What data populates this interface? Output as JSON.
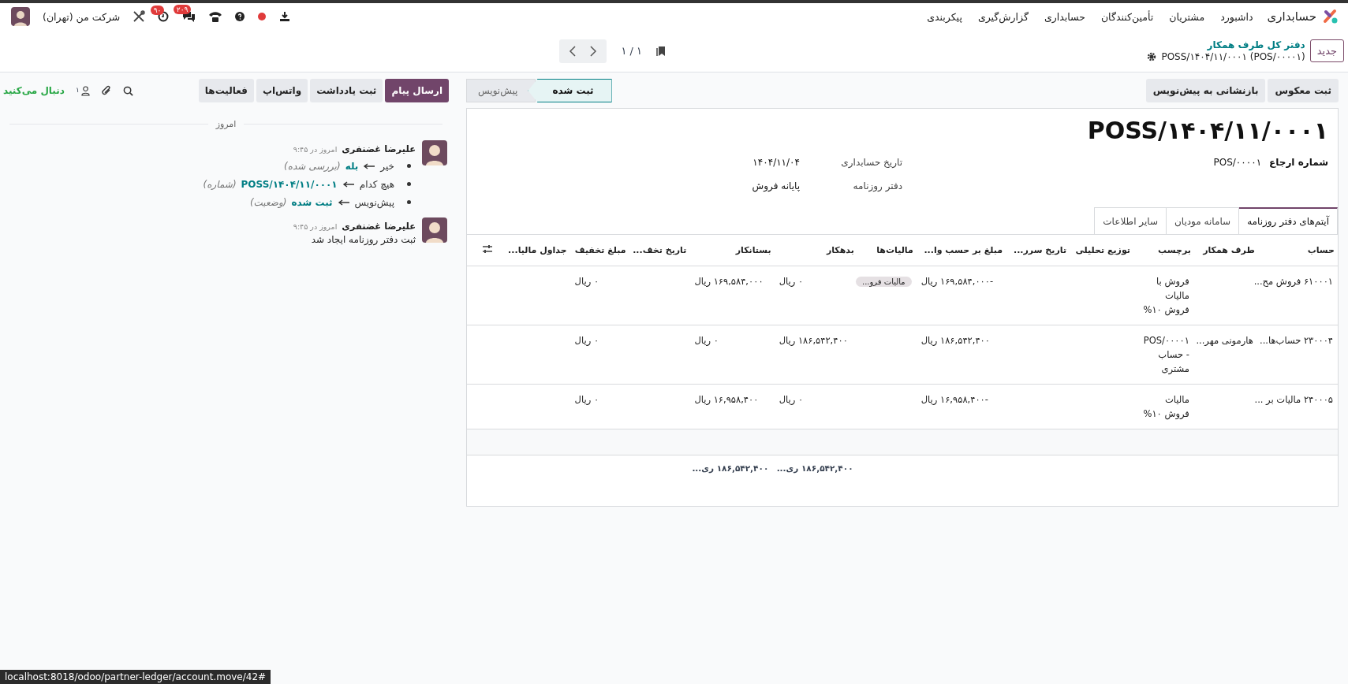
{
  "navbar": {
    "app_title": "حسابداری",
    "menu": [
      "داشبورد",
      "مشتریان",
      "تأمین‌کنندگان",
      "حسابداری",
      "گزارش‌گیری",
      "پیکربندی"
    ],
    "messages_badge": "۲۰۹",
    "activities_badge": "۹۰",
    "company": "شرکت من (تهران)"
  },
  "control_panel": {
    "new_button": "جدید",
    "breadcrumb": "دفتر کل طرف همکار",
    "record_name": "POSS/۱۴۰۴/۱۱/۰۰۰۱ (POS/۰۰۰۰۱)",
    "pager": "۱ / ۱"
  },
  "header_buttons": [
    "ثبت معکوس",
    "بازنشانی به پیش‌نویس"
  ],
  "statusbar": [
    {
      "label": "ثبت شده",
      "selected": true
    },
    {
      "label": "پیش‌نویس",
      "selected": false
    }
  ],
  "sheet": {
    "title": "POSS/۱۴۰۴/۱۱/۰۰۰۱",
    "group_1": [
      {
        "label": "شماره ارجاع",
        "value": "POS/۰۰۰۰۱"
      }
    ],
    "group_2": [
      {
        "label": "تاریخ حسابداری",
        "value": "۱۴۰۴/۱۱/۰۴"
      },
      {
        "label": "دفتر روزنامه",
        "value": "پایانه فروش"
      }
    ],
    "tabs": [
      {
        "label": "آیتم‌های دفتر روزنامه",
        "selected": true
      },
      {
        "label": "سامانه مودیان",
        "selected": false
      },
      {
        "label": "سایر اطلاعات",
        "selected": false
      }
    ],
    "table": {
      "columns": [
        {
          "label": "حساب"
        },
        {
          "label": "طرف همکار"
        },
        {
          "label": "برچسب"
        },
        {
          "label": "توزیع تحلیلی"
        },
        {
          "label": "تاریخ سرر..."
        },
        {
          "label": "مبلغ بر حسب وا..."
        },
        {
          "label": "مالیات‌ها"
        },
        {
          "label": "بدهکار",
          "total": "۱۸۶,۵۴۲,۴۰۰ ری..."
        },
        {
          "label": "بستانکار",
          "total": "۱۸۶,۵۴۲,۴۰۰ ری..."
        },
        {
          "label": "تاریخ تخف..."
        },
        {
          "label": "مبلغ تخفیف"
        },
        {
          "label": "جداول مالیا..."
        }
      ],
      "rows": [
        [
          "۶۱۰۰۰۱ فروش مح...",
          null,
          "فروش  با مالیات فروش ۱۰%",
          null,
          null,
          "-۱۶۹,۵۸۴,۰۰۰ ریال",
          [
            "مالیات فرو..."
          ],
          "۰ ریال",
          "۱۶۹,۵۸۴,۰۰۰ ریال",
          null,
          "۰ ریال",
          null
        ],
        [
          "۲۳۰۰۰۴ حساب‌ها...",
          "هارمونی مهر...",
          "POS/۰۰۰۰۱ - حساب مشتری",
          null,
          null,
          "۱۸۶,۵۴۲,۴۰۰ ریال",
          null,
          "۱۸۶,۵۴۲,۴۰۰ ریال",
          "۰ ریال",
          null,
          "۰ ریال",
          null
        ],
        [
          "۲۴۰۰۰۵ مالیات بر ...",
          null,
          "مالیات فروش ۱۰%",
          null,
          null,
          "-۱۶,۹۵۸,۴۰۰ ریال",
          null,
          "۰ ریال",
          "۱۶,۹۵۸,۴۰۰ ریال",
          null,
          "۰ ریال",
          null
        ]
      ]
    }
  },
  "chatter": {
    "buttons": [
      {
        "label": "ارسال پیام",
        "primary": true
      },
      {
        "label": "ثبت یادداشت",
        "primary": false
      },
      {
        "label": "واتس‌اپ",
        "primary": false
      },
      {
        "label": "فعالیت‌ها",
        "primary": false
      }
    ],
    "followers_count": "۱",
    "follow_label": "دنبال می‌کنید",
    "date_separator": "امروز",
    "messages": [
      {
        "kind": "tracking",
        "author": "علیرضا غضنفری",
        "time": "امروز در ۹:۴۵",
        "changes": [
          {
            "old": "خیر",
            "new": "بله",
            "field": "(بررسی شده)"
          },
          {
            "old": "هیچ کدام",
            "new": "POSS/۱۴۰۴/۱۱/۰۰۰۱",
            "field": "(شماره)"
          },
          {
            "old": "پیش‌نویس",
            "new": "ثبت شده",
            "field": "(وضعیت)"
          }
        ]
      },
      {
        "kind": "text",
        "author": "علیرضا غضنفری",
        "time": "امروز در ۹:۴۵",
        "body": "ثبت دفتر روزنامه ایجاد شد"
      }
    ]
  },
  "status_url": "localhost:8018/odoo/partner-ledger/account.move/42#"
}
